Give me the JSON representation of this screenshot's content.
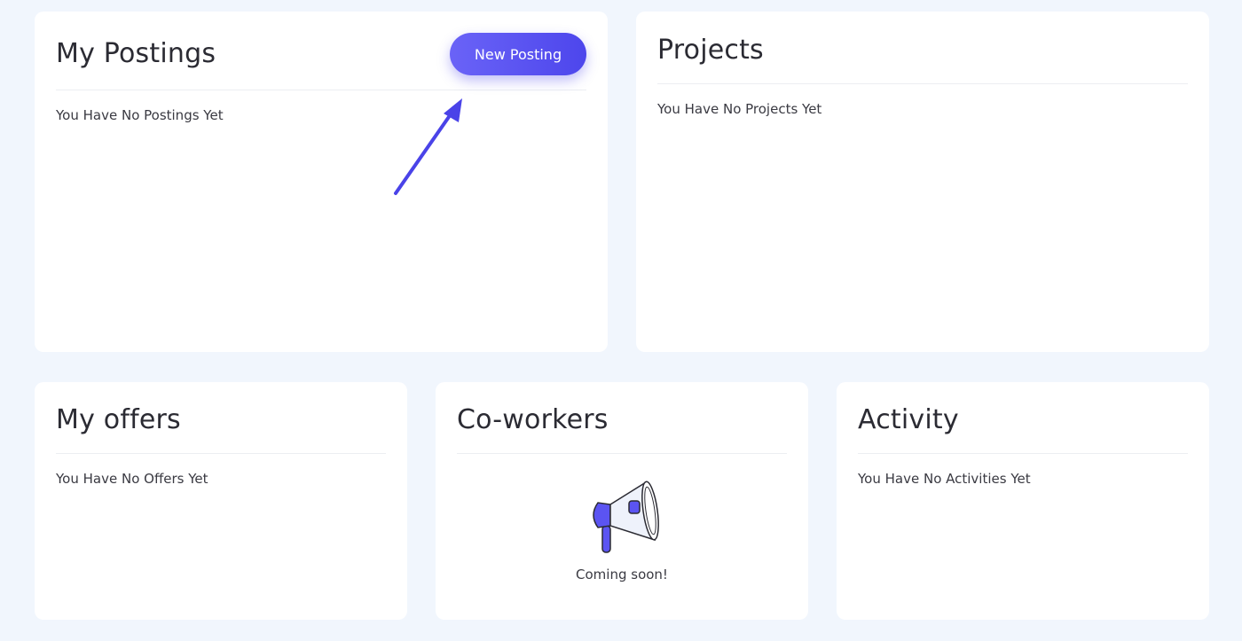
{
  "postings": {
    "title": "My Postings",
    "new_button_label": "New Posting",
    "empty_text": "You Have No Postings Yet"
  },
  "projects": {
    "title": "Projects",
    "empty_text": "You Have No Projects Yet"
  },
  "offers": {
    "title": "My offers",
    "empty_text": "You Have No Offers Yet"
  },
  "coworkers": {
    "title": "Co-workers",
    "icon": "megaphone-icon",
    "status_text": "Coming soon!"
  },
  "activity": {
    "title": "Activity",
    "empty_text": "You Have No Activities Yet"
  },
  "colors": {
    "accent": "#5b54f2",
    "background": "#f1f6fd",
    "card": "#ffffff"
  }
}
